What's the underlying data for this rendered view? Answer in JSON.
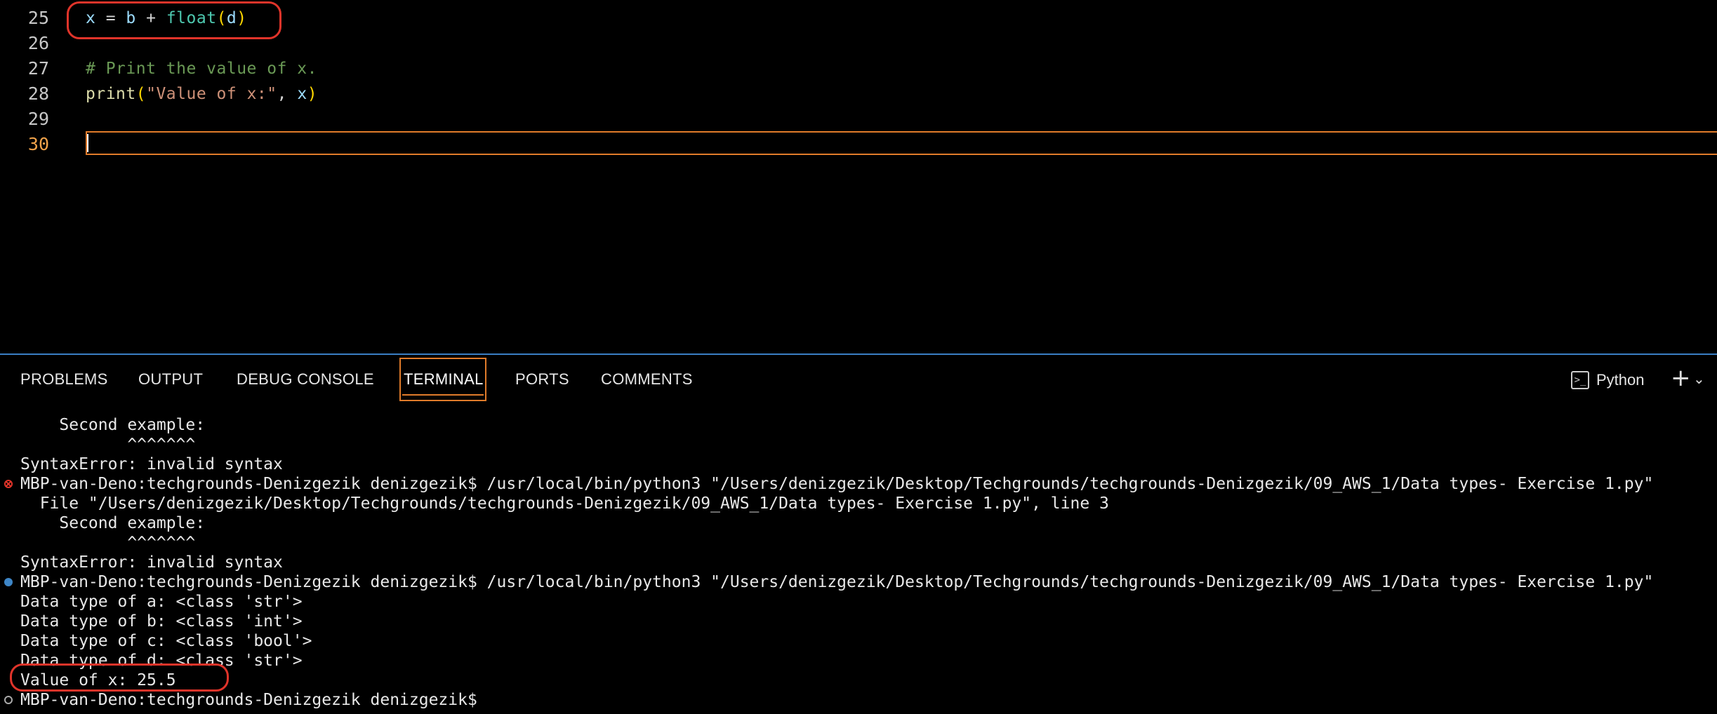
{
  "editor": {
    "lines": [
      {
        "num": "25",
        "tokens": [
          {
            "t": "x",
            "c": "k-var"
          },
          {
            "t": " = ",
            "c": "k-op"
          },
          {
            "t": "b",
            "c": "k-var"
          },
          {
            "t": " + ",
            "c": "k-op"
          },
          {
            "t": "float",
            "c": "k-builtin"
          },
          {
            "t": "(",
            "c": "k-paren"
          },
          {
            "t": "d",
            "c": "k-var"
          },
          {
            "t": ")",
            "c": "k-paren"
          }
        ]
      },
      {
        "num": "26",
        "tokens": []
      },
      {
        "num": "27",
        "tokens": [
          {
            "t": "# Print the value of x.",
            "c": "k-cmt"
          }
        ]
      },
      {
        "num": "28",
        "tokens": [
          {
            "t": "print",
            "c": "k-fn"
          },
          {
            "t": "(",
            "c": "k-paren"
          },
          {
            "t": "\"Value of x:\"",
            "c": "k-str"
          },
          {
            "t": ", ",
            "c": "k-op"
          },
          {
            "t": "x",
            "c": "k-var"
          },
          {
            "t": ")",
            "c": "k-paren"
          }
        ]
      },
      {
        "num": "29",
        "tokens": []
      },
      {
        "num": "30",
        "tokens": []
      }
    ],
    "active_line": "30"
  },
  "panel": {
    "tabs": [
      "PROBLEMS",
      "OUTPUT",
      "DEBUG CONSOLE",
      "TERMINAL",
      "PORTS",
      "COMMENTS"
    ],
    "active_tab": "TERMINAL",
    "terminal_profile": "Python"
  },
  "terminal": {
    "lines": [
      {
        "text": "    Second example:",
        "marker": ""
      },
      {
        "text": "           ^^^^^^^",
        "marker": ""
      },
      {
        "text": "SyntaxError: invalid syntax",
        "marker": ""
      },
      {
        "text": "MBP-van-Deno:techgrounds-Denizgezik denizgezik$ /usr/local/bin/python3 \"/Users/denizgezik/Desktop/Techgrounds/techgrounds-Denizgezik/09_AWS_1/Data types- Exercise 1.py\"",
        "marker": "error"
      },
      {
        "text": "  File \"/Users/denizgezik/Desktop/Techgrounds/techgrounds-Denizgezik/09_AWS_1/Data types- Exercise 1.py\", line 3",
        "marker": ""
      },
      {
        "text": "    Second example:",
        "marker": ""
      },
      {
        "text": "           ^^^^^^^",
        "marker": ""
      },
      {
        "text": "SyntaxError: invalid syntax",
        "marker": ""
      },
      {
        "text": "MBP-van-Deno:techgrounds-Denizgezik denizgezik$ /usr/local/bin/python3 \"/Users/denizgezik/Desktop/Techgrounds/techgrounds-Denizgezik/09_AWS_1/Data types- Exercise 1.py\"",
        "marker": "ok"
      },
      {
        "text": "Data type of a: <class 'str'>",
        "marker": ""
      },
      {
        "text": "Data type of b: <class 'int'>",
        "marker": ""
      },
      {
        "text": "Data type of c: <class 'bool'>",
        "marker": ""
      },
      {
        "text": "Data type of d: <class 'str'>",
        "marker": ""
      },
      {
        "text": "Value of x: 25.5",
        "marker": ""
      },
      {
        "text": "MBP-van-Deno:techgrounds-Denizgezik denizgezik$",
        "marker": "idle"
      }
    ]
  },
  "colors": {
    "accent_orange": "#e07b2a",
    "annotation_red": "#e0342a",
    "panel_border_blue": "#3a7fc4"
  }
}
